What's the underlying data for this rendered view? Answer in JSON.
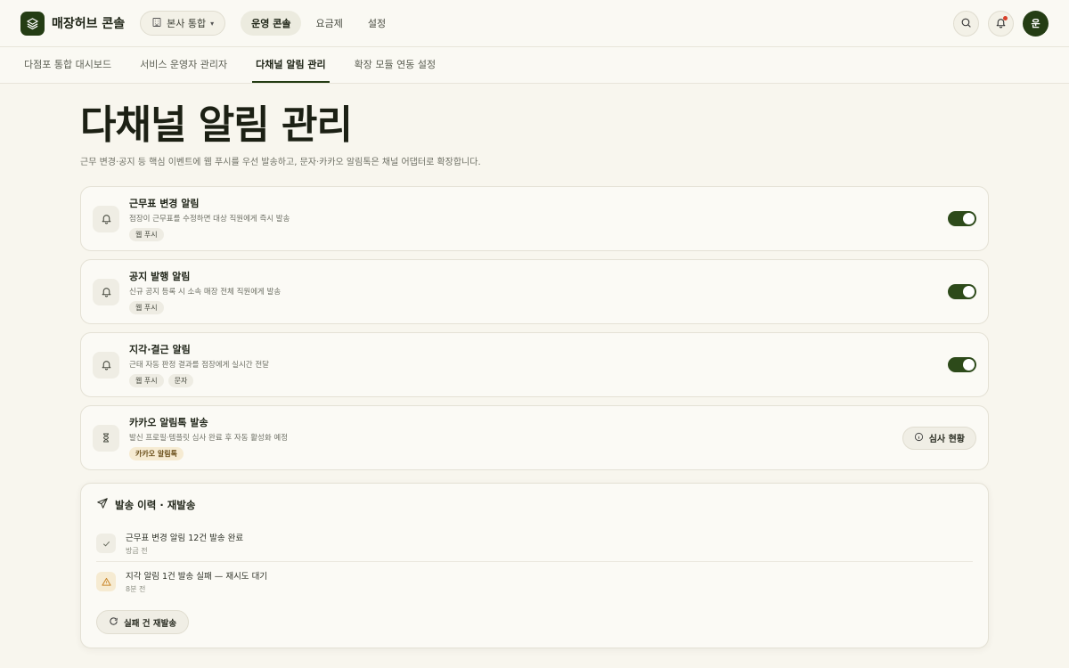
{
  "app": {
    "brand": "매장허브 콘솔",
    "org_select": "본사 통합",
    "nav": [
      "운영 콘솔",
      "요금제",
      "설정"
    ],
    "avatar_initial": "운"
  },
  "subtabs": [
    "다점포 통합 대시보드",
    "서비스 운영자 관리자",
    "다채널 알림 관리",
    "확장 모듈 연동 설정"
  ],
  "page": {
    "title": "다채널 알림 관리",
    "subtitle": "근무 변경·공지 등 핵심 이벤트에 웹 푸시를 우선 발송하고, 문자·카카오 알림톡은 채널 어댑터로 확장합니다."
  },
  "alerts": [
    {
      "title": "근무표 변경 알림",
      "desc": "점장이 근무표를 수정하면 대상 직원에게 즉시 발송",
      "tags": [
        "웹 푸시"
      ],
      "enabled": true
    },
    {
      "title": "공지 발행 알림",
      "desc": "신규 공지 등록 시 소속 매장 전체 직원에게 발송",
      "tags": [
        "웹 푸시"
      ],
      "enabled": true
    },
    {
      "title": "지각·결근 알림",
      "desc": "근태 자동 판정 결과를 점장에게 실시간 전달",
      "tags": [
        "웹 푸시",
        "문자"
      ],
      "enabled": true
    },
    {
      "title": "카카오 알림톡 발송",
      "desc": "발신 프로필·템플릿 심사 완료 후 자동 활성화 예정",
      "tags": [
        "카카오 알림톡"
      ],
      "button": "심사 현황"
    }
  ],
  "history": {
    "title": "발송 이력 · 재발송",
    "items": [
      {
        "msg": "근무표 변경 알림 12건 발송 완료",
        "time": "방금 전",
        "icon": "check-icon"
      },
      {
        "msg": "지각 알림 1건 발송 실패 — 재시도 대기",
        "time": "8분 전",
        "icon": "warning-icon"
      }
    ],
    "resend_label": "실패 건 재발송"
  },
  "colors": {
    "accent": "#243d14",
    "background": "#f8f6ee",
    "warning": "#c9862a",
    "notification_dot": "#d8402a"
  }
}
